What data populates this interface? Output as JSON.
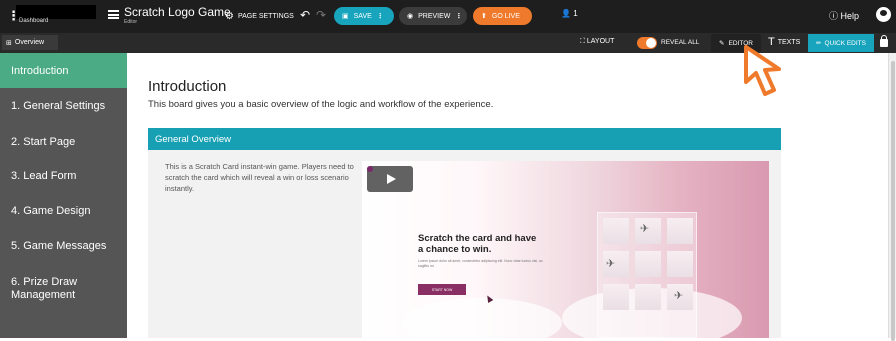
{
  "topbar": {
    "dashboard_label": "Dashboard",
    "game_title": "Scratch Logo Game",
    "mode_label": "Editor",
    "page_settings": "PAGE SETTINGS",
    "save": "SAVE",
    "preview": "PREVIEW",
    "go_live": "GO LIVE",
    "users_count": "1",
    "help": "Help"
  },
  "toolbar": {
    "overview": "Overview",
    "layout": "LAYOUT",
    "reveal_all": "REVEAL ALL",
    "reveal_all_on": true,
    "editor": "EDITOR",
    "texts": "TEXTS",
    "quick_edits": "QUICK EDITS"
  },
  "sidebar": {
    "items": [
      {
        "label": "Introduction",
        "active": true
      },
      {
        "label": "1. General Settings"
      },
      {
        "label": "2. Start Page"
      },
      {
        "label": "3. Lead Form"
      },
      {
        "label": "4. Game Design"
      },
      {
        "label": "5. Game Messages"
      },
      {
        "label": "6. Prize Draw\nManagement"
      }
    ]
  },
  "main": {
    "title": "Introduction",
    "description": "This board gives you a basic overview of the logic and workflow of the experience.",
    "section_title": "General Overview",
    "section_text": "This is a Scratch Card instant-win game. Players need to scratch the card which will reveal a win or loss scenario instantly.",
    "preview": {
      "headline": "Scratch the card and have a chance to win.",
      "subtext": "Lorem ipsum dolor sit amet, consectetur adipiscing elit. Nunc vitae luctus nisi, ac sagittis mi.",
      "button": "START NOW"
    }
  },
  "colors": {
    "accent": "#17a4bc",
    "go_live": "#f07a2c",
    "sidebar_active": "#4aab84",
    "sidebar_bg": "#555555",
    "topbar_bg": "#1e1e1e"
  }
}
